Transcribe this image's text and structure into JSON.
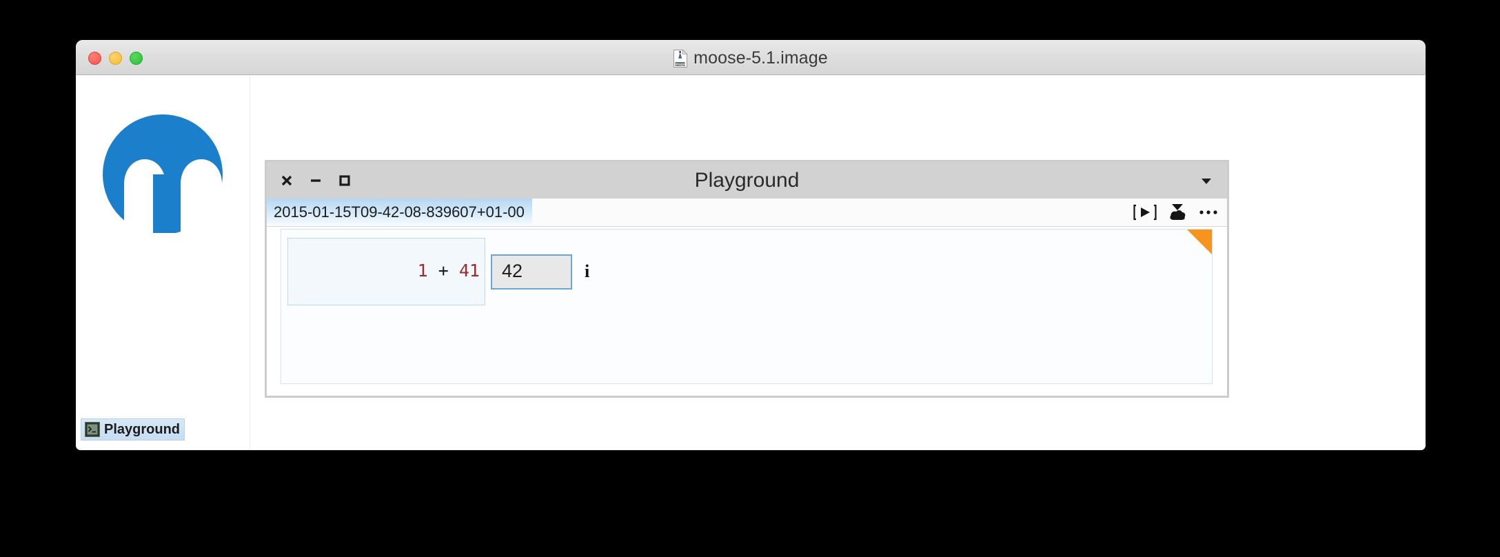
{
  "os_window": {
    "title": "moose-5.1.image",
    "doc_icon": "image-document-icon",
    "traffic_lights": [
      {
        "name": "close-button",
        "color": "#f5544c"
      },
      {
        "name": "minimize-button",
        "color": "#f7bc2e"
      },
      {
        "name": "maximize-button",
        "color": "#29c233"
      }
    ]
  },
  "logo": {
    "name": "moose-logo",
    "color": "#1b7fcc"
  },
  "taskbar": {
    "items": [
      {
        "label": "Playground",
        "icon": "terminal-icon"
      }
    ]
  },
  "playground": {
    "title": "Playground",
    "window_buttons": [
      {
        "name": "close",
        "glyph": "×"
      },
      {
        "name": "minimize",
        "glyph": "−"
      },
      {
        "name": "maximize",
        "glyph": "□"
      }
    ],
    "menu_chevron": "▼",
    "tab": {
      "label": "2015-01-15T09-42-08-839607+01-00"
    },
    "toolbar_icons": [
      {
        "name": "do-it-play-icon",
        "glyph": "[▶]"
      },
      {
        "name": "publish-cloud-icon",
        "glyph": "cloud-down"
      },
      {
        "name": "more-options-icon",
        "glyph": "•••"
      }
    ],
    "code": {
      "tokens": [
        {
          "text": "1",
          "type": "num"
        },
        {
          "text": " + ",
          "type": "op"
        },
        {
          "text": "41",
          "type": "num"
        }
      ],
      "plain": "1 + 41"
    },
    "result": {
      "value": "42"
    },
    "info_glyph": "i",
    "marker_color": "#f7941e"
  }
}
